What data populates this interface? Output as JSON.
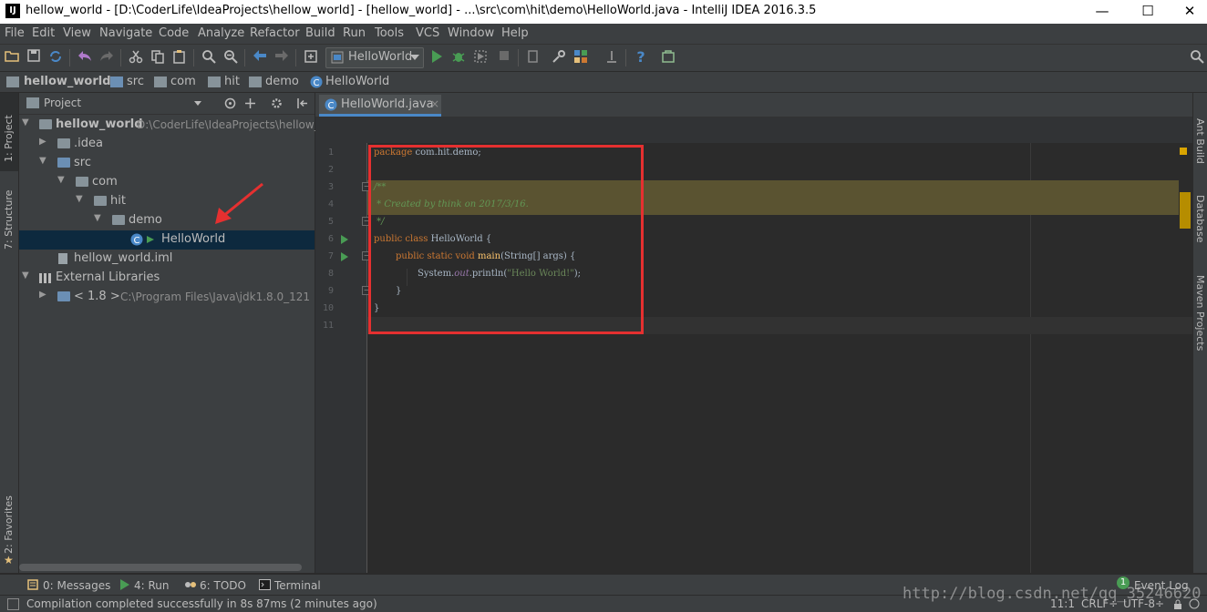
{
  "window": {
    "app_logo": "IJ",
    "title": "hellow_world - [D:\\CoderLife\\IdeaProjects\\hellow_world] - [hellow_world] - ...\\src\\com\\hit\\demo\\HelloWorld.java - IntelliJ IDEA 2016.3.5",
    "minimize": "—",
    "maximize": "☐",
    "close": "✕"
  },
  "menu": [
    "File",
    "Edit",
    "View",
    "Navigate",
    "Code",
    "Analyze",
    "Refactor",
    "Build",
    "Run",
    "Tools",
    "VCS",
    "Window",
    "Help"
  ],
  "toolbar": {
    "run_config": "HelloWorld",
    "help": "?"
  },
  "navbar": [
    "hellow_world",
    "src",
    "com",
    "hit",
    "demo",
    "HelloWorld"
  ],
  "left_tools": {
    "project": "1: Project",
    "structure": "7: Structure",
    "favorites": "2: Favorites"
  },
  "project_panel": {
    "header": "Project",
    "tree": [
      {
        "label": "hellow_world",
        "path": "D:\\CoderLife\\IdeaProjects\\hellow_",
        "depth": 0,
        "expanded": true,
        "icon": "module-folder-icon",
        "bold": true
      },
      {
        "label": ".idea",
        "depth": 1,
        "expanded": false,
        "icon": "folder-icon"
      },
      {
        "label": "src",
        "depth": 1,
        "expanded": true,
        "icon": "source-folder-icon"
      },
      {
        "label": "com",
        "depth": 2,
        "expanded": true,
        "icon": "package-icon"
      },
      {
        "label": "hit",
        "depth": 3,
        "expanded": true,
        "icon": "package-icon"
      },
      {
        "label": "demo",
        "depth": 4,
        "expanded": true,
        "icon": "package-icon"
      },
      {
        "label": "HelloWorld",
        "depth": 5,
        "icon": "java-class-icon",
        "selected": true
      },
      {
        "label": "hellow_world.iml",
        "depth": 1,
        "icon": "iml-file-icon"
      },
      {
        "label": "External Libraries",
        "depth": 0,
        "expanded": true,
        "icon": "library-icon"
      },
      {
        "label": "< 1.8 >",
        "path": "C:\\Program Files\\Java\\jdk1.8.0_121",
        "depth": 1,
        "expanded": false,
        "icon": "jdk-icon"
      }
    ]
  },
  "editor": {
    "tab": "HelloWorld.java",
    "tab_close": "×",
    "line_numbers": [
      "1",
      "2",
      "3",
      "4",
      "5",
      "6",
      "7",
      "8",
      "9",
      "10",
      "11"
    ],
    "lines": {
      "l1_kw": "package",
      "l1_rest": " com.hit.demo;",
      "l3": "/**",
      "l4": " * Created by think on 2017/3/16.",
      "l5": " */",
      "l6_kw": "public class",
      "l6_rest": " HelloWorld {",
      "l7_kw": "public static void",
      "l7_fn": "main",
      "l7_rest": "(String[] args) {",
      "l8_a": "System.",
      "l8_fld": "out",
      "l8_b": ".println(",
      "l8_str": "\"Hello World!\"",
      "l8_c": ");",
      "l9": "}",
      "l10": "}"
    }
  },
  "right_tools": {
    "ant": "Ant Build",
    "database": "Database",
    "maven": "Maven Projects"
  },
  "bottom_tools": {
    "messages": "0: Messages",
    "run": "4: Run",
    "todo": "6: TODO",
    "terminal": "Terminal",
    "event_count": "1",
    "event_log": "Event Log"
  },
  "status": {
    "message": "Compilation completed successfully in 8s 87ms (2 minutes ago)",
    "position": "11:1",
    "line_sep": "CRLF÷",
    "encoding": "UTF-8÷"
  },
  "watermark": "http://blog.csdn.net/qq_35246620",
  "colors": {
    "accent": "#4a88c7",
    "annotation": "#e53030",
    "run_green": "#499c54"
  }
}
